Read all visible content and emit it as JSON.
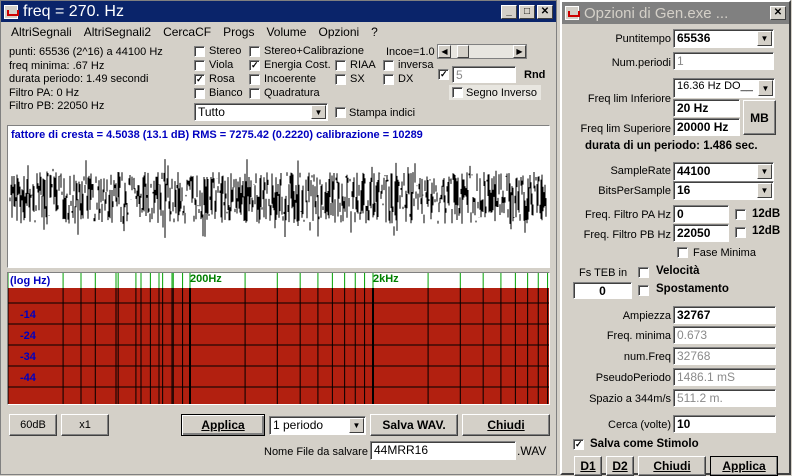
{
  "main": {
    "title": "freq = 270. Hz",
    "menu": [
      "AltriSegnali",
      "AltriSegnali2",
      "CercaCF",
      "Progs",
      "Volume",
      "Opzioni",
      "?"
    ],
    "info": [
      "punti: 65536 (2^16) a 44100 Hz",
      "freq minima: .67 Hz",
      "durata periodo: 1.49 secondi",
      "Filtro PA: 0 Hz",
      "Filtro PB: 22050 Hz"
    ],
    "checks_col1": [
      {
        "label": "Stereo",
        "checked": false
      },
      {
        "label": "Viola",
        "checked": false
      },
      {
        "label": "Rosa",
        "checked": true
      },
      {
        "label": "Bianco",
        "checked": false
      }
    ],
    "checks_col2": [
      {
        "label": "Stereo+Calibrazione",
        "checked": false
      },
      {
        "label": "Energia Cost.",
        "checked": true
      },
      {
        "label": "Incoerente",
        "checked": false
      },
      {
        "label": "Quadratura",
        "checked": false
      }
    ],
    "checks_col3": [
      {
        "label": "RIAA",
        "checked": false
      },
      {
        "label": "SX",
        "checked": false
      }
    ],
    "checks_col4": [
      {
        "label": "inversa",
        "checked": false
      },
      {
        "label": "DX",
        "checked": false
      }
    ],
    "incoe_label": "Incoe=1.0",
    "rnd_value": "5",
    "rnd_label": "Rnd",
    "segno_inverso": "Segno Inverso",
    "tutto": "Tutto",
    "stampa_indici": "Stampa indici",
    "stats": "fattore di cresta = 4.5038 (13.1 dB)  RMS = 7275.42 (0.2220)   calibrazione = 10289",
    "spectrum": {
      "loglabel": "(log Hz)",
      "f200": "200Hz",
      "f2k": "2kHz",
      "db_labels": [
        "-14",
        "-24",
        "-34",
        "-44"
      ]
    },
    "buttons": {
      "b60db": "60dB",
      "x1": "x1",
      "applica": "Applica",
      "periodo": "1 periodo",
      "salva": "Salva WAV.",
      "chiudi": "Chiudi"
    },
    "nome_file_label": "Nome File da salvare",
    "nome_file": "44MRR16",
    "wav_ext": ".WAV"
  },
  "opt": {
    "title": "Opzioni di Gen.exe ...",
    "puntitempo_label": "Puntitempo",
    "puntitempo": "65536",
    "numperiodi_label": "Num.periodi",
    "numperiodi": "1",
    "freqlim_combo": "16.36 Hz DO__",
    "freqinf_label": "Freq lim Inferiore",
    "freqinf": "20 Hz",
    "freqsup_label": "Freq lim Superiore",
    "freqsup": "20000 Hz",
    "mb": "MB",
    "durata": "durata di un periodo: 1.486 sec.",
    "samplerate_label": "SampleRate",
    "samplerate": "44100",
    "bits_label": "BitsPerSample",
    "bits": "16",
    "pa_label": "Freq. Filtro PA Hz",
    "pa": "0",
    "pb_label": "Freq. Filtro PB Hz",
    "pb": "22050",
    "db12": "12dB",
    "fase": "Fase Minima",
    "fsteb": "Fs TEB  in",
    "velocita": "Velocità",
    "zero": "0",
    "spostamento": "Spostamento",
    "ampiezza_label": "Ampiezza",
    "ampiezza": "32767",
    "fmin_label": "Freq. minima",
    "fmin": "0.673",
    "numfreq_label": "num.Freq",
    "numfreq": "32768",
    "pseudo_label": "PseudoPeriodo",
    "pseudo": "1486.1 mS",
    "spazio_label": "Spazio a 344m/s",
    "spazio": "511.2 m.",
    "cerca_label": "Cerca (volte)",
    "cerca": "10",
    "salva_stimolo": "Salva come Stimolo",
    "d1": "D1",
    "d2": "D2",
    "chiudi": "Chiudi",
    "applica": "Applica"
  },
  "colors": {
    "title_active": "#0a246a",
    "spectrum_fill": "#b22010",
    "stats_blue": "#0000c0",
    "freq_green": "#008000"
  }
}
